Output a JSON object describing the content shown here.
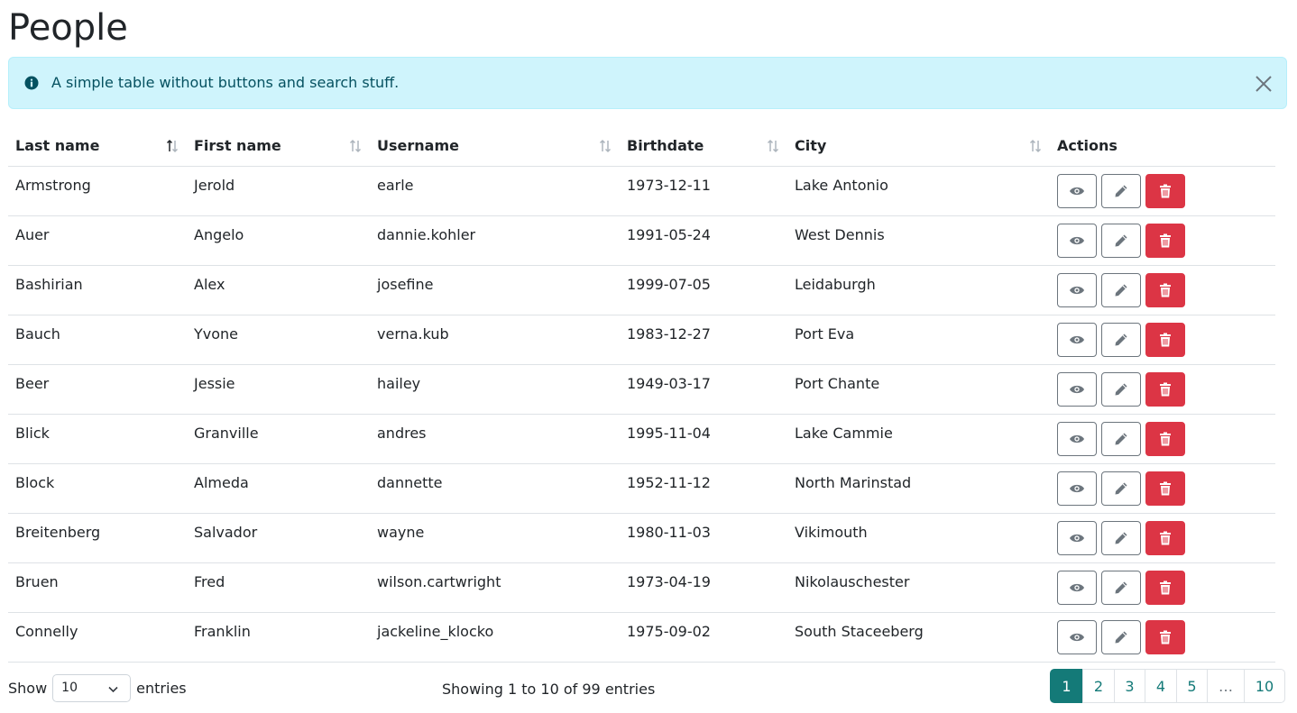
{
  "page": {
    "title": "People"
  },
  "alert": {
    "text": "A simple table without buttons and search stuff."
  },
  "table": {
    "columns": [
      {
        "label": "Last name",
        "sort": "asc"
      },
      {
        "label": "First name",
        "sort": "none"
      },
      {
        "label": "Username",
        "sort": "none"
      },
      {
        "label": "Birthdate",
        "sort": "none"
      },
      {
        "label": "City",
        "sort": "none"
      },
      {
        "label": "Actions",
        "sort": ""
      }
    ],
    "rows": [
      {
        "last": "Armstrong",
        "first": "Jerold",
        "username": "earle",
        "birthdate": "1973-12-11",
        "city": "Lake Antonio"
      },
      {
        "last": "Auer",
        "first": "Angelo",
        "username": "dannie.kohler",
        "birthdate": "1991-05-24",
        "city": "West Dennis"
      },
      {
        "last": "Bashirian",
        "first": "Alex",
        "username": "josefine",
        "birthdate": "1999-07-05",
        "city": "Leidaburgh"
      },
      {
        "last": "Bauch",
        "first": "Yvone",
        "username": "verna.kub",
        "birthdate": "1983-12-27",
        "city": "Port Eva"
      },
      {
        "last": "Beer",
        "first": "Jessie",
        "username": "hailey",
        "birthdate": "1949-03-17",
        "city": "Port Chante"
      },
      {
        "last": "Blick",
        "first": "Granville",
        "username": "andres",
        "birthdate": "1995-11-04",
        "city": "Lake Cammie"
      },
      {
        "last": "Block",
        "first": "Almeda",
        "username": "dannette",
        "birthdate": "1952-11-12",
        "city": "North Marinstad"
      },
      {
        "last": "Breitenberg",
        "first": "Salvador",
        "username": "wayne",
        "birthdate": "1980-11-03",
        "city": "Vikimouth"
      },
      {
        "last": "Bruen",
        "first": "Fred",
        "username": "wilson.cartwright",
        "birthdate": "1973-04-19",
        "city": "Nikolauschester"
      },
      {
        "last": "Connelly",
        "first": "Franklin",
        "username": "jackeline_klocko",
        "birthdate": "1975-09-02",
        "city": "South Staceeberg"
      }
    ]
  },
  "footer": {
    "show_label": "Show",
    "page_size": "10",
    "entries_label": "entries",
    "info": "Showing 1 to 10 of 99 entries"
  },
  "pagination": {
    "pages": [
      {
        "label": "1",
        "active": true
      },
      {
        "label": "2",
        "active": false
      },
      {
        "label": "3",
        "active": false
      },
      {
        "label": "4",
        "active": false
      },
      {
        "label": "5",
        "active": false
      },
      {
        "label": "…",
        "active": false
      },
      {
        "label": "10",
        "active": false
      }
    ]
  },
  "colors": {
    "accent": "#147a78",
    "danger": "#dc3545",
    "alert_bg": "#cff4fc",
    "alert_text": "#055160",
    "icons": [
      "info-icon",
      "close-icon",
      "sort-icon",
      "eye-icon",
      "pencil-icon",
      "trash-icon",
      "chevron-down-icon"
    ]
  }
}
